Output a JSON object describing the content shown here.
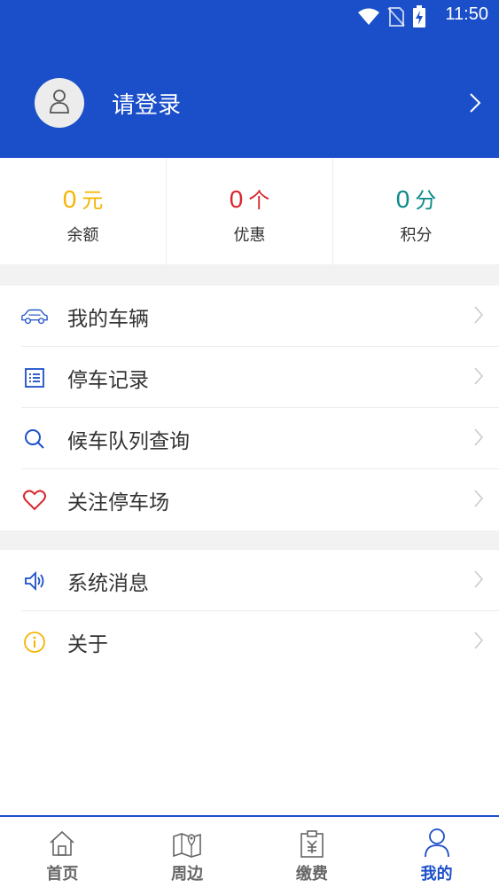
{
  "status_bar": {
    "time": "11:50"
  },
  "header": {
    "login_text": "请登录",
    "background": "#1b4fc9"
  },
  "stats": [
    {
      "value": "0",
      "unit": "元",
      "label": "余额",
      "color": "#f5b400"
    },
    {
      "value": "0",
      "unit": "个",
      "label": "优惠",
      "color": "#d9262e"
    },
    {
      "value": "0",
      "unit": "分",
      "label": "积分",
      "color": "#0a8a8a"
    }
  ],
  "menu_group_1": [
    {
      "label": "我的车辆",
      "icon": "car-icon"
    },
    {
      "label": "停车记录",
      "icon": "list-icon"
    },
    {
      "label": "候车队列查询",
      "icon": "search-icon"
    },
    {
      "label": "关注停车场",
      "icon": "heart-icon"
    }
  ],
  "menu_group_2": [
    {
      "label": "系统消息",
      "icon": "speaker-icon"
    },
    {
      "label": "关于",
      "icon": "info-icon"
    }
  ],
  "bottom_nav": [
    {
      "label": "首页",
      "icon": "home-icon",
      "active": false
    },
    {
      "label": "周边",
      "icon": "map-icon",
      "active": false
    },
    {
      "label": "缴费",
      "icon": "payment-icon",
      "active": false
    },
    {
      "label": "我的",
      "icon": "user-icon",
      "active": true
    }
  ]
}
